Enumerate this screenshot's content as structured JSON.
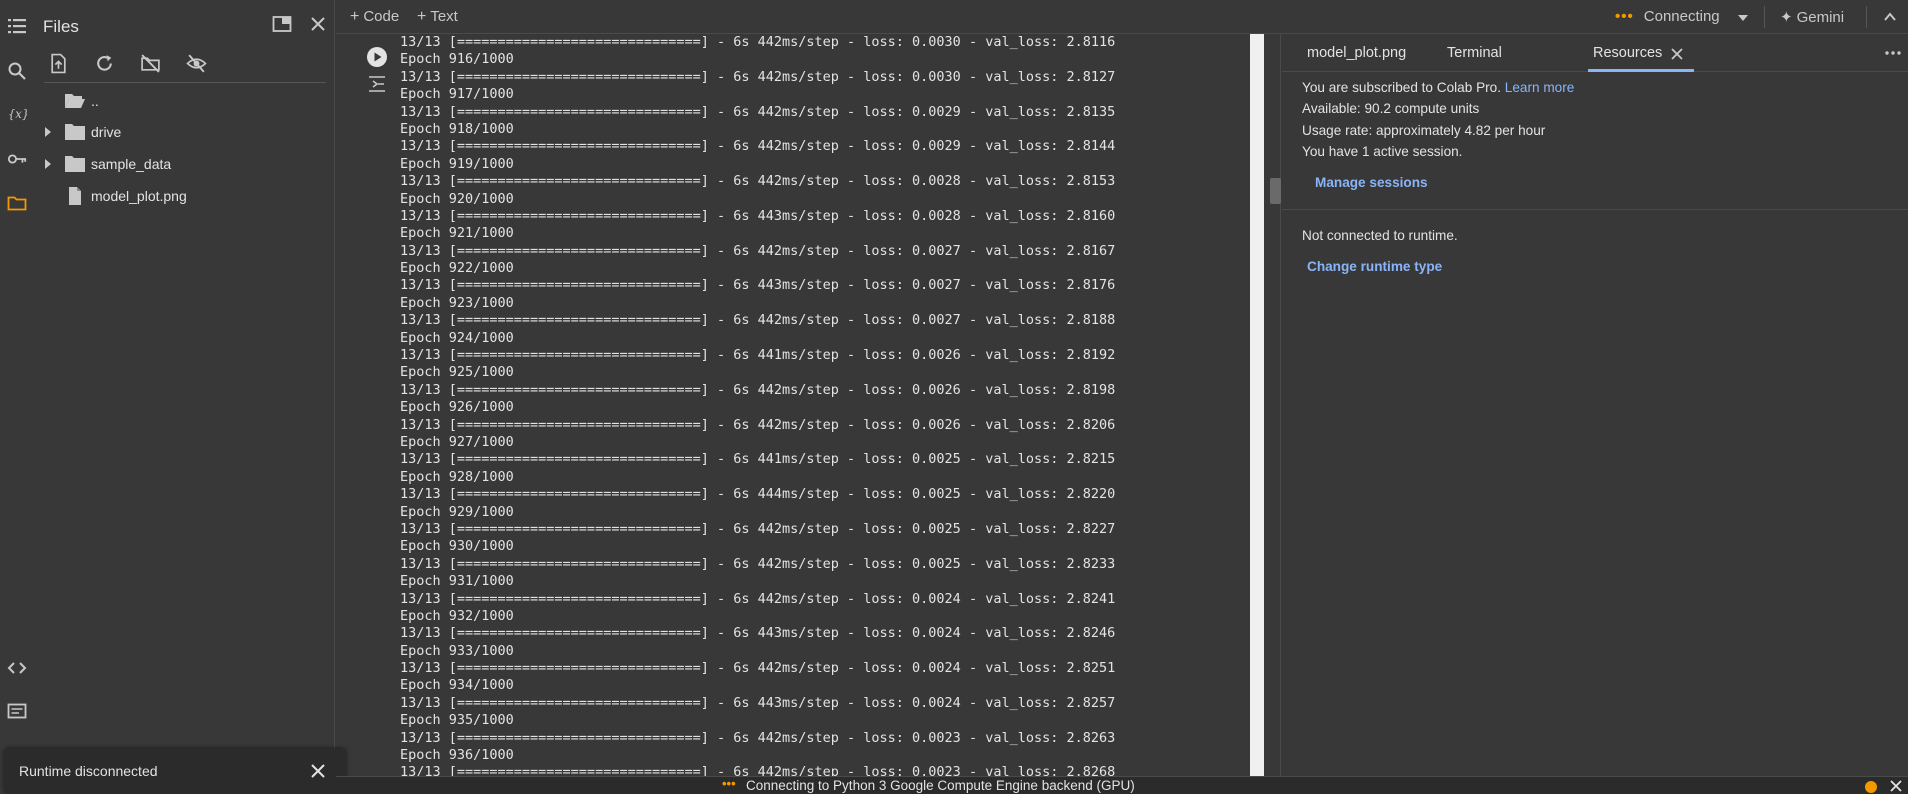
{
  "rail": {
    "icons": [
      "table-of-contents-icon",
      "search-icon",
      "variables-icon",
      "key-icon",
      "folder-icon",
      "code-snippets-icon",
      "command-palette-icon"
    ]
  },
  "files": {
    "title": "Files",
    "tree": [
      {
        "name": "..",
        "type": "folder-open",
        "expandable": false
      },
      {
        "name": "drive",
        "type": "folder",
        "expandable": true
      },
      {
        "name": "sample_data",
        "type": "folder",
        "expandable": true
      },
      {
        "name": "model_plot.png",
        "type": "file",
        "expandable": false
      }
    ]
  },
  "toast": {
    "text": "Runtime disconnected"
  },
  "toolbar": {
    "code_label": "Code",
    "text_label": "Text",
    "connecting_label": "Connecting",
    "gemini_label": "Gemini"
  },
  "output": {
    "lines": [
      "13/13 [==============================] - 6s 442ms/step - loss: 0.0030 - val_loss: 2.8116",
      "Epoch 916/1000",
      "13/13 [==============================] - 6s 442ms/step - loss: 0.0030 - val_loss: 2.8127",
      "Epoch 917/1000",
      "13/13 [==============================] - 6s 442ms/step - loss: 0.0029 - val_loss: 2.8135",
      "Epoch 918/1000",
      "13/13 [==============================] - 6s 442ms/step - loss: 0.0029 - val_loss: 2.8144",
      "Epoch 919/1000",
      "13/13 [==============================] - 6s 442ms/step - loss: 0.0028 - val_loss: 2.8153",
      "Epoch 920/1000",
      "13/13 [==============================] - 6s 443ms/step - loss: 0.0028 - val_loss: 2.8160",
      "Epoch 921/1000",
      "13/13 [==============================] - 6s 442ms/step - loss: 0.0027 - val_loss: 2.8167",
      "Epoch 922/1000",
      "13/13 [==============================] - 6s 443ms/step - loss: 0.0027 - val_loss: 2.8176",
      "Epoch 923/1000",
      "13/13 [==============================] - 6s 442ms/step - loss: 0.0027 - val_loss: 2.8188",
      "Epoch 924/1000",
      "13/13 [==============================] - 6s 441ms/step - loss: 0.0026 - val_loss: 2.8192",
      "Epoch 925/1000",
      "13/13 [==============================] - 6s 442ms/step - loss: 0.0026 - val_loss: 2.8198",
      "Epoch 926/1000",
      "13/13 [==============================] - 6s 442ms/step - loss: 0.0026 - val_loss: 2.8206",
      "Epoch 927/1000",
      "13/13 [==============================] - 6s 441ms/step - loss: 0.0025 - val_loss: 2.8215",
      "Epoch 928/1000",
      "13/13 [==============================] - 6s 444ms/step - loss: 0.0025 - val_loss: 2.8220",
      "Epoch 929/1000",
      "13/13 [==============================] - 6s 442ms/step - loss: 0.0025 - val_loss: 2.8227",
      "Epoch 930/1000",
      "13/13 [==============================] - 6s 442ms/step - loss: 0.0025 - val_loss: 2.8233",
      "Epoch 931/1000",
      "13/13 [==============================] - 6s 442ms/step - loss: 0.0024 - val_loss: 2.8241",
      "Epoch 932/1000",
      "13/13 [==============================] - 6s 443ms/step - loss: 0.0024 - val_loss: 2.8246",
      "Epoch 933/1000",
      "13/13 [==============================] - 6s 442ms/step - loss: 0.0024 - val_loss: 2.8251",
      "Epoch 934/1000",
      "13/13 [==============================] - 6s 443ms/step - loss: 0.0024 - val_loss: 2.8257",
      "Epoch 935/1000",
      "13/13 [==============================] - 6s 442ms/step - loss: 0.0023 - val_loss: 2.8263",
      "Epoch 936/1000",
      "13/13 [==============================] - 6s 442ms/step - loss: 0.0023 - val_loss: 2.8268"
    ]
  },
  "right_panel": {
    "tabs": [
      "model_plot.png",
      "Terminal",
      "Resources"
    ],
    "subscribed_text": "You are subscribed to Colab Pro.",
    "learn_more": "Learn more",
    "available": "Available: 90.2 compute units",
    "usage": "Usage rate: approximately 4.82 per hour",
    "sessions": "You have 1 active session.",
    "manage_sessions": "Manage sessions",
    "not_connected": "Not connected to runtime.",
    "change_runtime": "Change runtime type"
  },
  "status": {
    "text": "Connecting to Python 3 Google Compute Engine backend (GPU)"
  },
  "colors": {
    "background": "#383838",
    "accent_link": "#8ab4f8",
    "status_orange": "#f29900"
  }
}
